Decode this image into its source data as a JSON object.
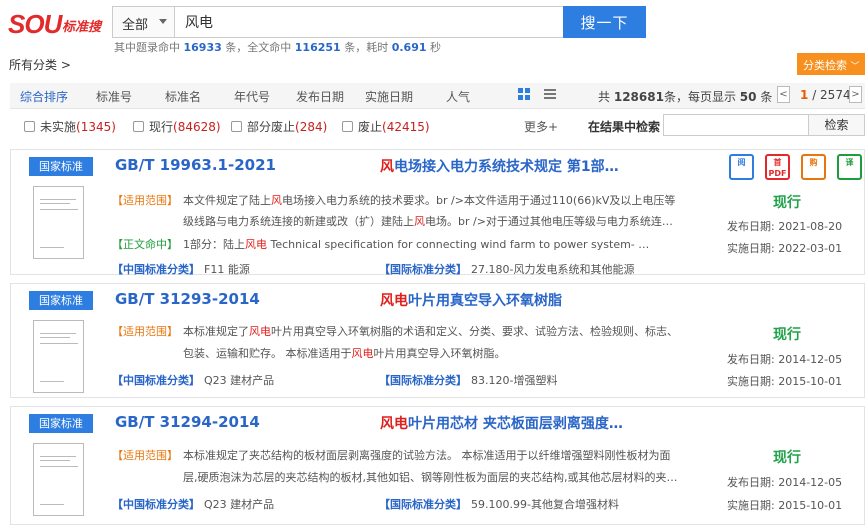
{
  "logo": {
    "brand": "SOU",
    "name": "标准搜"
  },
  "search": {
    "scope": "全部",
    "query": "风电",
    "button": "搜一下"
  },
  "stats": {
    "p1": "其中题录命中",
    "title_hits": "16933",
    "p2": "条，全文命中",
    "fulltext_hits": "116251",
    "p3": "条，耗时",
    "time": "0.691",
    "p4": "秒"
  },
  "all_categories": "所有分类 >",
  "category_search": "分类检索",
  "sort": {
    "items": [
      "综合排序",
      "标准号",
      "标准名",
      "年代号",
      "发布日期",
      "实施日期",
      "人气"
    ],
    "active": "综合排序"
  },
  "pager": {
    "p1": "共",
    "total": "128681",
    "p2": "条，每页显示",
    "per_page": "50",
    "p3": "条",
    "current": "1",
    "pages": "/ 2574",
    "prev": "<",
    "next": ">"
  },
  "filters": [
    {
      "label": "未实施",
      "count": "(1345)"
    },
    {
      "label": "现行",
      "count": "(84628)"
    },
    {
      "label": "部分废止",
      "count": "(284)"
    },
    {
      "label": "废止",
      "count": "(42415)"
    }
  ],
  "more": "更多+",
  "in_results": {
    "label": "在结果中检索",
    "button": "检索"
  },
  "labels": {
    "scope": "【适用范围】",
    "body": "【正文命中】",
    "cn_class": "【中国标准分类】",
    "intl_class": "【国际标准分类】",
    "pub": "发布日期:",
    "impl": "实施日期:"
  },
  "icons": {
    "read": "阅",
    "pdf": "首PDF",
    "buy": "购",
    "translate": "译"
  },
  "results": [
    {
      "badge": "国家标准",
      "number": "GB/T 19963.1-2021",
      "title_hl": "风",
      "title_rest": "电场接入电力系统技术规定  第1部…",
      "scope1_a": "本文件规定了陆上",
      "scope1_hl": "风",
      "scope1_b": "电场接入电力系统的技术要求。br />本文件适用于通过110(66)kV及以上电压等",
      "scope2_a": "级线路与电力系统连接的新建或改（扩）建陆上",
      "scope2_hl": "风",
      "scope2_b": "电场。br />对于通过其他电压等级与电力系统连…",
      "body_a": "1部分：陆上",
      "body_hl": "风电",
      "body_b": " Technical specification for connecting wind farm to power system-        …",
      "cn_class": "F11  能源",
      "intl_class": "27.180-风力发电系统和其他能源",
      "status": "现行",
      "pub_date": "2021-08-20",
      "impl_date": "2022-03-01"
    },
    {
      "badge": "国家标准",
      "number": "GB/T 31293-2014",
      "title_hl": "风电",
      "title_rest": "叶片用真空导入环氧树脂",
      "scope1_a": "本标准规定了",
      "scope1_hl": "风电",
      "scope1_b": "叶片用真空导入环氧树脂的术语和定义、分类、要求、试验方法、检验规则、标志、",
      "scope2_a": "包装、运输和贮存。 本标准适用于",
      "scope2_hl": "风电",
      "scope2_b": "叶片用真空导入环氧树脂。",
      "cn_class": "Q23  建材产品",
      "intl_class": "83.120-增强塑料",
      "status": "现行",
      "pub_date": "2014-12-05",
      "impl_date": "2015-10-01"
    },
    {
      "badge": "国家标准",
      "number": "GB/T 31294-2014",
      "title_hl": "风电",
      "title_rest": "叶片用芯材  夹芯板面层剥离强度…",
      "scope1_a": "本标准规定了夹芯结构的板材面层剥离强度的试验方法。 本标准适用于以纤维增强塑料刚性板材为面",
      "scope1_hl": "",
      "scope1_b": "",
      "scope2_a": "层,硬质泡沫为芯层的夹芯结构的板材,其他如铝、钢等刚性板为面层的夹芯结构,或其他芯层材料的夹…",
      "scope2_hl": "",
      "scope2_b": "",
      "cn_class": "Q23  建材产品",
      "intl_class": "59.100.99-其他复合增强材料",
      "status": "现行",
      "pub_date": "2014-12-05",
      "impl_date": "2015-10-01"
    }
  ]
}
